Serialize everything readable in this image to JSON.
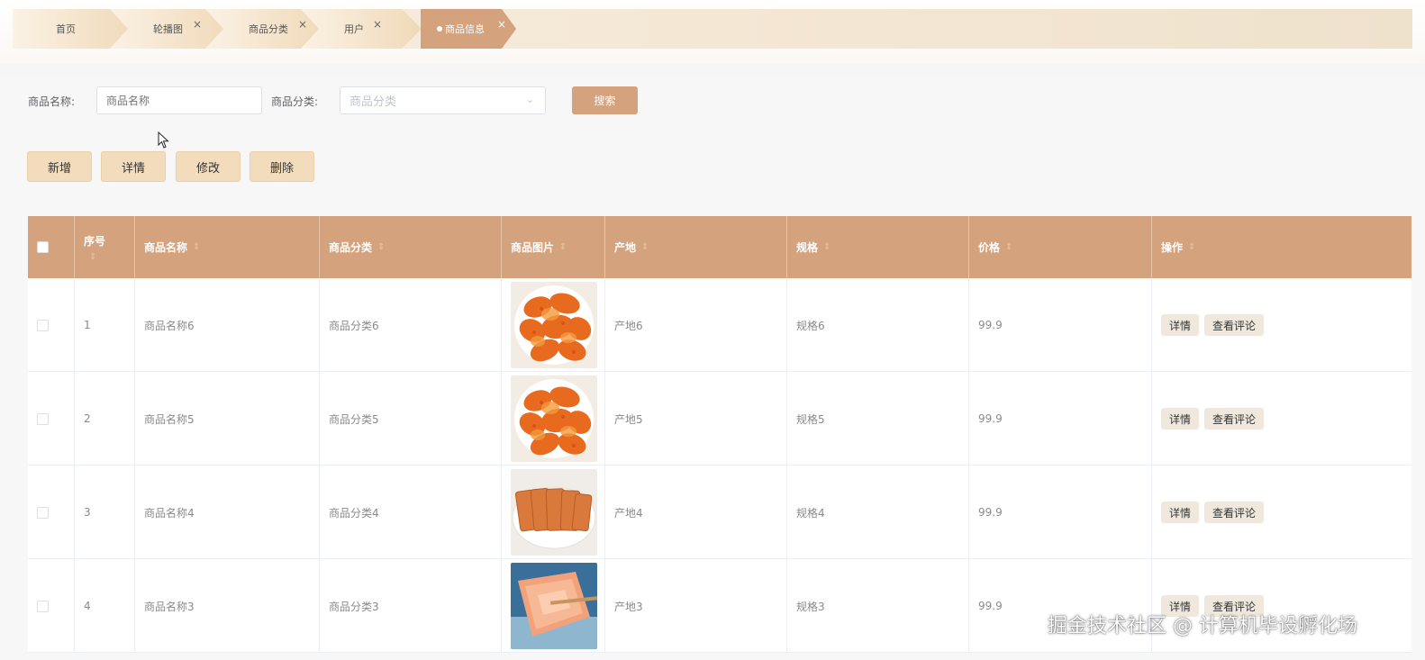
{
  "tabs": [
    {
      "label": "首页",
      "closable": false
    },
    {
      "label": "轮播图",
      "closable": true
    },
    {
      "label": "商品分类",
      "closable": true
    },
    {
      "label": "用户",
      "closable": true
    },
    {
      "label": "商品信息",
      "closable": true,
      "active": true
    }
  ],
  "close_glyph": "×",
  "search": {
    "name_label": "商品名称:",
    "name_placeholder": "商品名称",
    "category_label": "商品分类:",
    "category_placeholder": "商品分类",
    "search_button": "搜索"
  },
  "actions": {
    "add": "新增",
    "detail": "详情",
    "edit": "修改",
    "delete": "删除"
  },
  "table": {
    "headers": {
      "seq": "序号",
      "name": "商品名称",
      "category": "商品分类",
      "image": "商品图片",
      "origin": "产地",
      "spec": "规格",
      "price": "价格",
      "ops": "操作"
    },
    "sort_glyph": "⇕",
    "rows": [
      {
        "seq": "1",
        "name": "商品名称6",
        "category": "商品分类6",
        "image": "chips",
        "origin": "产地6",
        "spec": "规格6",
        "price": "99.9",
        "detail_btn": "详情",
        "comment_btn": "查看评论"
      },
      {
        "seq": "2",
        "name": "商品名称5",
        "category": "商品分类5",
        "image": "chips",
        "origin": "产地5",
        "spec": "规格5",
        "price": "99.9",
        "detail_btn": "详情",
        "comment_btn": "查看评论"
      },
      {
        "seq": "3",
        "name": "商品名称4",
        "category": "商品分类4",
        "image": "sausage",
        "origin": "产地4",
        "spec": "规格4",
        "price": "99.9",
        "detail_btn": "详情",
        "comment_btn": "查看评论"
      },
      {
        "seq": "4",
        "name": "商品名称3",
        "category": "商品分类3",
        "image": "jerky",
        "origin": "产地3",
        "spec": "规格3",
        "price": "99.9",
        "detail_btn": "详情",
        "comment_btn": "查看评论"
      }
    ]
  },
  "watermark": "掘金技术社区 @ 计算机毕设孵化场",
  "colors": {
    "accent": "#d4a27c",
    "action_btn": "#f2dcbc"
  }
}
